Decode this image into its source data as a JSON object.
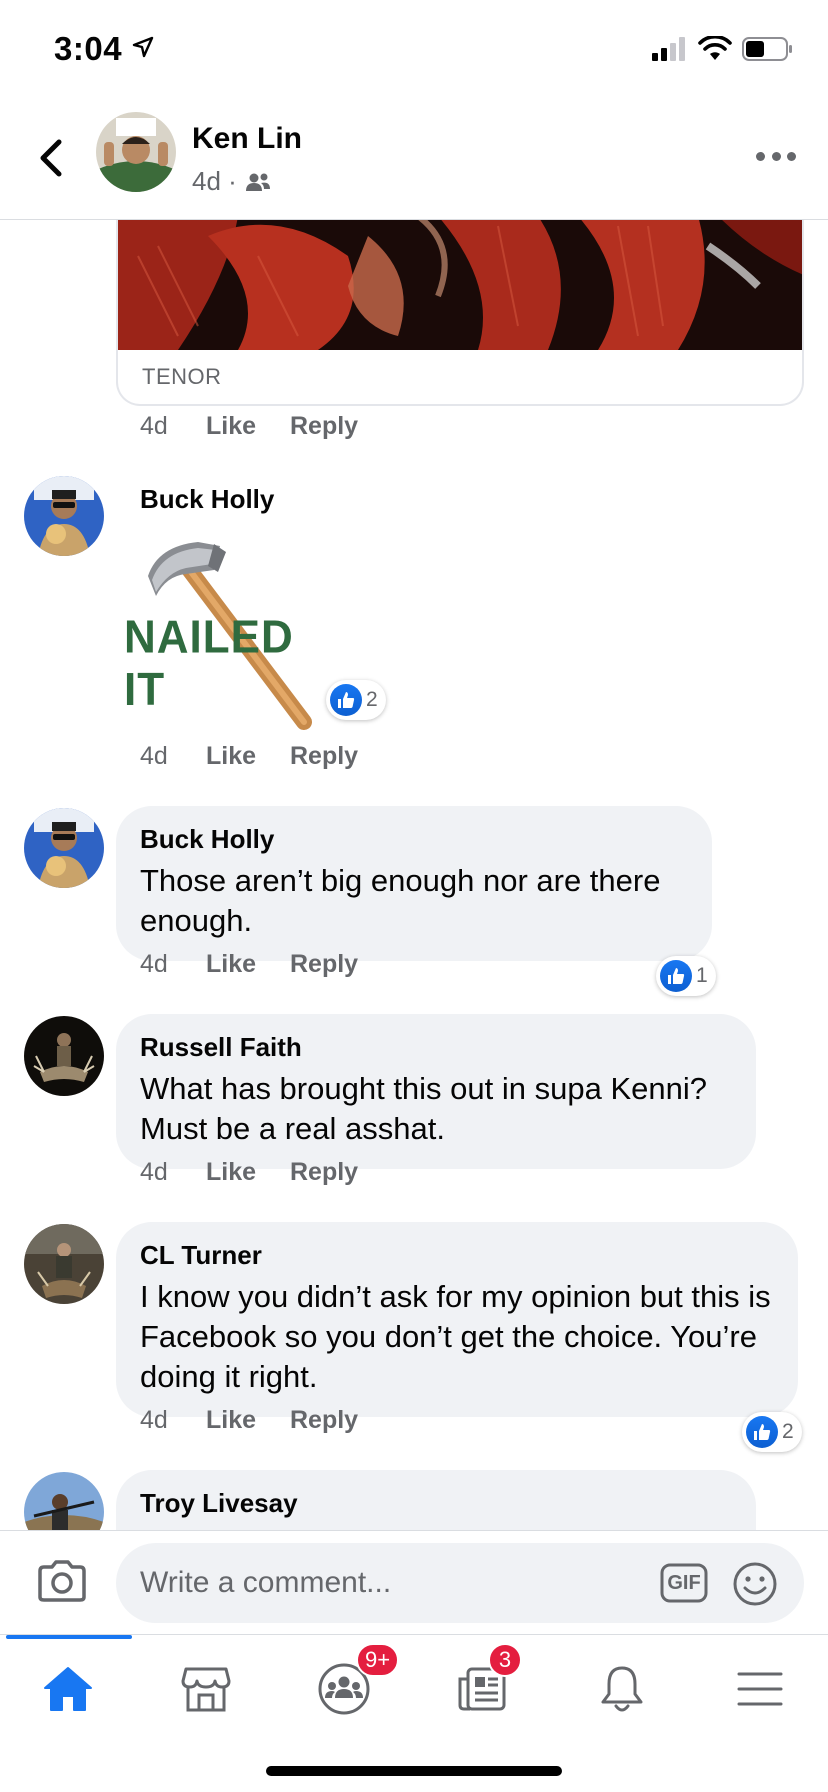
{
  "status_bar": {
    "time": "3:04"
  },
  "header": {
    "name": "Ken Lin",
    "meta": "4d ·"
  },
  "gif_card": {
    "source": "TENOR"
  },
  "comments": [
    {
      "time": "4d",
      "like": "Like",
      "reply": "Reply"
    },
    {
      "author": "Buck Holly",
      "sticker_text": "NAILED IT",
      "reaction_count": "2",
      "time": "4d",
      "like": "Like",
      "reply": "Reply"
    },
    {
      "author": "Buck Holly",
      "text": "Those aren’t big enough nor are there enough.",
      "reaction_count": "1",
      "time": "4d",
      "like": "Like",
      "reply": "Reply"
    },
    {
      "author": "Russell Faith",
      "text": "What has brought this out in supa Kenni? Must be a real asshat.",
      "time": "4d",
      "like": "Like",
      "reply": "Reply"
    },
    {
      "author": "CL Turner",
      "text": "I know you didn’t ask for my opinion but this is Facebook so you don’t get the choice. You’re doing it right.",
      "reaction_count": "2",
      "time": "4d",
      "like": "Like",
      "reply": "Reply"
    },
    {
      "author": "Troy Livesay"
    }
  ],
  "composer": {
    "placeholder": "Write a comment...",
    "gif_label": "GIF"
  },
  "tabbar": {
    "badges": {
      "groups": "9+",
      "news": "3"
    }
  },
  "colors": {
    "accent": "#1877f2",
    "badge": "#e41e3f",
    "bubble": "#f0f2f5",
    "secondary_text": "#65676b"
  }
}
